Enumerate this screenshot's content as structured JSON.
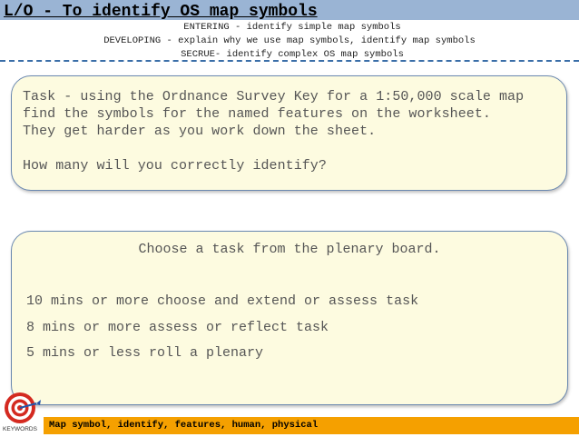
{
  "header": {
    "title": "L/O - To identify OS map symbols",
    "objectives": [
      "ENTERING - identify simple map symbols",
      "DEVELOPING - explain why we use map symbols, identify map symbols",
      "SECRUE- identify complex OS map symbols"
    ]
  },
  "task_box": {
    "lines": [
      "Task - using the Ordnance Survey Key for a 1:50,000 scale map",
      "find the symbols for the named features on the worksheet.",
      "They get harder as you work down the sheet.",
      "How many will you correctly identify?"
    ]
  },
  "plenary_box": {
    "heading": "Choose a task from the plenary board.",
    "options": [
      "10 mins or more choose and extend or assess task",
      "8 mins or more assess or reflect task",
      "5 mins or less roll a plenary"
    ]
  },
  "footer": {
    "keywords": "Map symbol, identify, features, human, physical",
    "logo_text": "KEYWORDS",
    "colors": {
      "keyword_bar": "#f5a000",
      "title_bar": "#9ab4d4"
    }
  }
}
